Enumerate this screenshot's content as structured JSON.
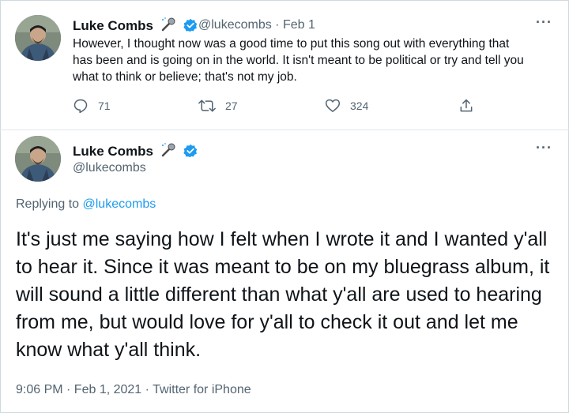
{
  "tweet1": {
    "display_name": "Luke Combs",
    "handle": "@lukecombs",
    "separator": "·",
    "date": "Feb 1",
    "text": "However, I thought now was a good time to put this song out with everything that has been and is going on in the world. It isn't meant to be political or try and tell you what to think or believe; that's not my job.",
    "more": "···",
    "replies": "71",
    "retweets": "27",
    "likes": "324"
  },
  "tweet2": {
    "display_name": "Luke Combs",
    "handle": "@lukecombs",
    "more": "···",
    "replying_prefix": "Replying to ",
    "replying_handle": "@lukecombs",
    "text": "It's just me saying how I felt when I wrote it and I wanted y'all to hear it. Since it was meant to be on my bluegrass album, it will sound a little different than what y'all are used to hearing from me, but would love for y'all to check it out and let me know what y'all think.",
    "timestamp": "9:06 PM · Feb 1, 2021 · Twitter for iPhone"
  },
  "icons": {
    "verified": "verified-badge-icon",
    "microphone": "microphone-icon",
    "reply": "reply-icon",
    "retweet": "retweet-icon",
    "like": "heart-icon",
    "share": "share-icon"
  },
  "colors": {
    "accent": "#1d9bf0",
    "muted": "#536471",
    "text": "#0f1419"
  }
}
